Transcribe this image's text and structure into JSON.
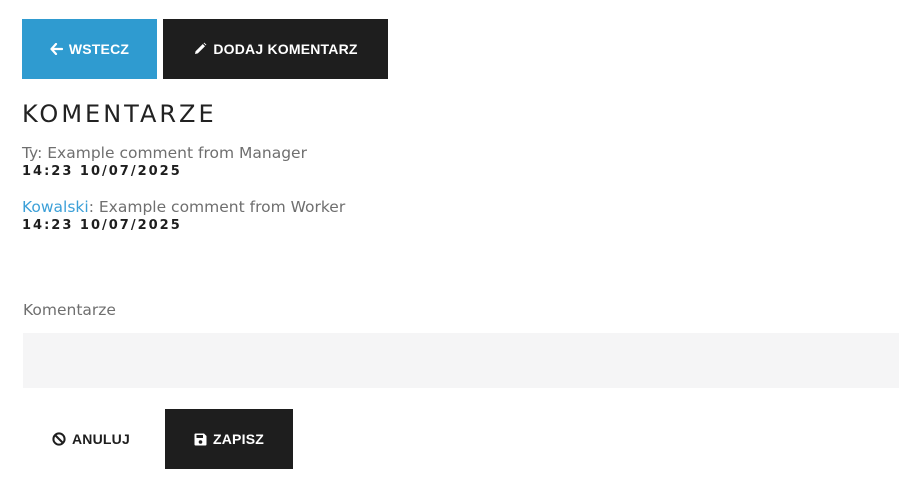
{
  "toolbar": {
    "back_label": "WSTECZ",
    "back_icon": "arrow-left-icon",
    "add_comment_label": "DODAJ KOMENTARZ",
    "add_comment_icon": "pencil-icon",
    "back_color": "#2f9bd0",
    "add_comment_color": "#1e1e1e"
  },
  "section": {
    "title": "KOMENTARZE"
  },
  "comments": [
    {
      "author": "Ty",
      "author_is_link": false,
      "separator": ": ",
      "text": "Example comment from Manager",
      "time": "14:23 10/07/2025"
    },
    {
      "author": "Kowalski",
      "author_is_link": true,
      "author_color": "#3ca0d8",
      "separator": ": ",
      "text": "Example comment from Worker",
      "time": "14:23 10/07/2025"
    }
  ],
  "form": {
    "label": "Komentarze",
    "value": "",
    "cancel_label": "ANULUJ",
    "cancel_icon": "ban-icon",
    "save_label": "ZAPISZ",
    "save_icon": "floppy-disk-icon"
  }
}
